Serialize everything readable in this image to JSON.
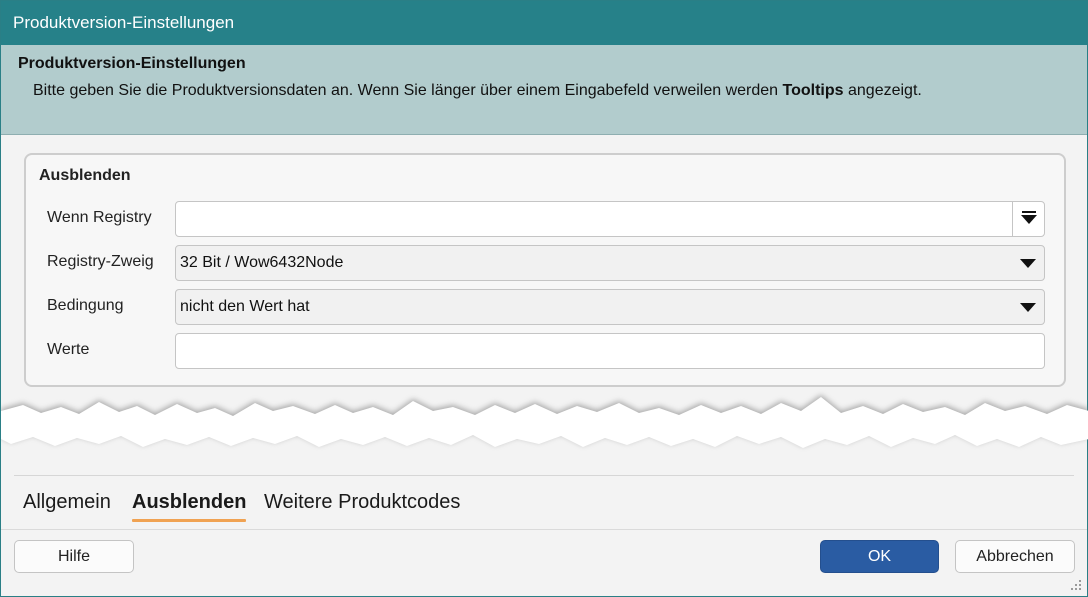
{
  "window": {
    "title": "Produktversion-Einstellungen"
  },
  "header": {
    "title": "Produktversion-Einstellungen",
    "description_before": "Bitte geben Sie die Produktversionsdaten an. Wenn Sie länger über einem Eingabefeld verweilen werden ",
    "description_bold": "Tooltips",
    "description_after": " angezeigt."
  },
  "group": {
    "title": "Ausblenden",
    "rows": [
      {
        "label": "Wenn Registry",
        "value": ""
      },
      {
        "label": "Registry-Zweig",
        "value": "32 Bit / Wow6432Node"
      },
      {
        "label": "Bedingung",
        "value": "nicht den Wert hat"
      },
      {
        "label": "Werte",
        "value": ""
      }
    ]
  },
  "tabs": [
    {
      "label": "Allgemein",
      "active": false
    },
    {
      "label": "Ausblenden",
      "active": true
    },
    {
      "label": "Weitere Produktcodes",
      "active": false
    }
  ],
  "buttons": {
    "help": "Hilfe",
    "ok": "OK",
    "cancel": "Abbrechen"
  },
  "colors": {
    "titlebar": "#268189",
    "header": "#b2cccd",
    "primary_button": "#2a5ca3",
    "active_tab_underline": "#f0a252"
  },
  "icons": {
    "registry_picker": "chevron-down-bar-icon",
    "dropdown": "chevron-down-icon",
    "resize": "resize-grip-icon"
  }
}
